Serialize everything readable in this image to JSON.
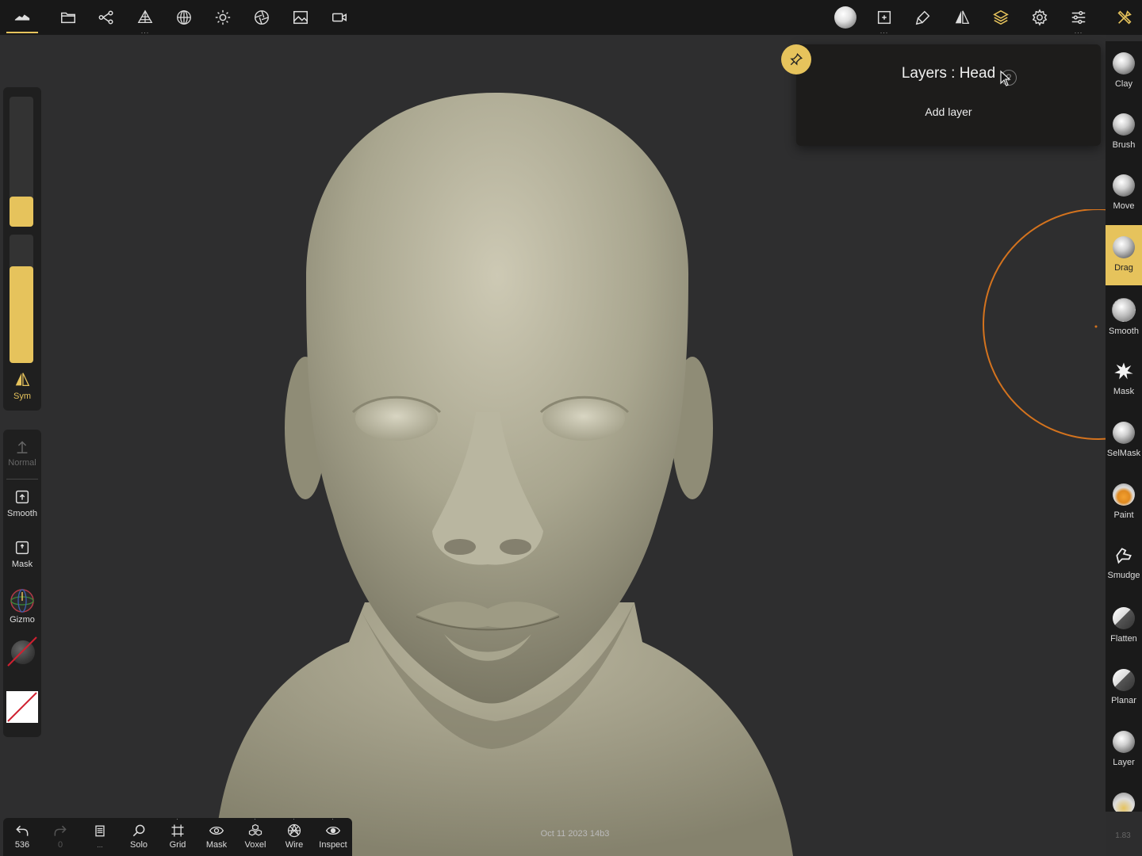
{
  "top_toolbar": {
    "left_icons": [
      "nomad-logo-icon",
      "folder-icon",
      "scene-graph-icon",
      "topology-icon",
      "material-sphere-icon",
      "light-icon",
      "camera-lens-icon",
      "image-icon",
      "video-camera-icon"
    ],
    "right_icons": [
      "material-preview-icon",
      "frame-icon",
      "paint-brush-icon",
      "symmetry-icon",
      "layers-icon",
      "settings-icon",
      "sliders-icon",
      "tools-icon"
    ]
  },
  "left_panel": {
    "sym_label": "Sym",
    "normal_label": "Normal",
    "smooth_label": "Smooth",
    "mask_label": "Mask",
    "gizmo_label": "Gizmo",
    "radius_level": 0.0,
    "intensity_level": 1.0
  },
  "layers_panel": {
    "title": "Layers : Head",
    "help": "?",
    "add_layer_label": "Add layer"
  },
  "right_tools": [
    {
      "label": "Clay"
    },
    {
      "label": "Brush"
    },
    {
      "label": "Move"
    },
    {
      "label": "Drag",
      "active": true
    },
    {
      "label": "Smooth"
    },
    {
      "label": "Mask"
    },
    {
      "label": "SelMask"
    },
    {
      "label": "Paint"
    },
    {
      "label": "Smudge"
    },
    {
      "label": "Flatten"
    },
    {
      "label": "Planar"
    },
    {
      "label": "Layer"
    }
  ],
  "bottom_bar": {
    "undo_count": "536",
    "redo_count": "0",
    "solo_label": "Solo",
    "grid_label": "Grid",
    "mask_label": "Mask",
    "voxel_label": "Voxel",
    "wire_label": "Wire",
    "inspect_label": "Inspect"
  },
  "viewport": {
    "date_text": "Oct 11 2023 14b3",
    "version_text": "1.83"
  },
  "colors": {
    "accent": "#e6c35c",
    "brush_circle": "#d4731e",
    "model": "#a9a68f"
  }
}
